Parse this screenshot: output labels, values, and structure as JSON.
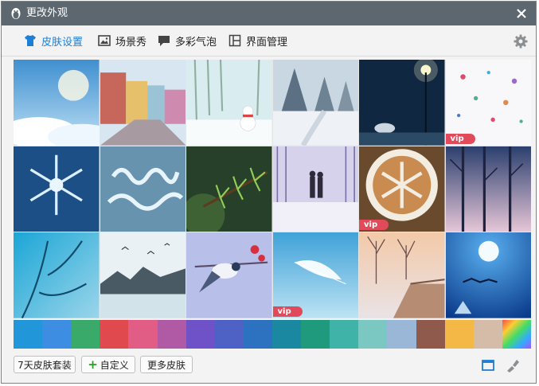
{
  "window": {
    "title": "更改外观"
  },
  "tabs": [
    {
      "label": "皮肤设置",
      "active": true
    },
    {
      "label": "场景秀",
      "active": false
    },
    {
      "label": "多彩气泡",
      "active": false
    },
    {
      "label": "界面管理",
      "active": false
    }
  ],
  "skins": [
    {
      "subject": "sky and clouds",
      "vip": false
    },
    {
      "subject": "colorful street",
      "vip": false
    },
    {
      "subject": "snowman forest",
      "vip": false
    },
    {
      "subject": "snowy pine trees",
      "vip": false
    },
    {
      "subject": "night lamp with umbrella",
      "vip": false
    },
    {
      "subject": "snowflake pattern",
      "vip": true,
      "badge": "vip"
    },
    {
      "subject": "ice snowflake",
      "vip": false
    },
    {
      "subject": "Merry Christmas frost",
      "vip": false
    },
    {
      "subject": "pine branch",
      "vip": false
    },
    {
      "subject": "couple in snow",
      "vip": false
    },
    {
      "subject": "latte art snowflake",
      "vip": true,
      "badge": "vip"
    },
    {
      "subject": "purple winter forest",
      "vip": false
    },
    {
      "subject": "icy branches",
      "vip": false
    },
    {
      "subject": "frozen lake with birds",
      "vip": false
    },
    {
      "subject": "bird on branch",
      "vip": false
    },
    {
      "subject": "white feather",
      "vip": true,
      "badge": "vip"
    },
    {
      "subject": "sunset walkway",
      "vip": false
    },
    {
      "subject": "moon and reindeer",
      "vip": false
    }
  ],
  "swatches": [
    "#2196d8",
    "#3d8de3",
    "#3aaa6b",
    "#e04a4f",
    "#e25d85",
    "#b05aa6",
    "#6f52c7",
    "#4e62c5",
    "#2d72c1",
    "#1b88a2",
    "#1f9a7c",
    "#3fb3a8",
    "#7bc8c2",
    "#9ab7d8",
    "#8f5a4c",
    "#f3b846",
    "#d4bca8",
    "rainbow"
  ],
  "bottom": {
    "btn_7days": "7天皮肤套装",
    "btn_custom": "自定义",
    "btn_more": "更多皮肤"
  },
  "colors": {
    "titlebar": "#5d676f",
    "accent": "#1e7fd6",
    "vip": "#e04a5a"
  },
  "icons": [
    "penguin-icon",
    "close-icon",
    "shirt-icon",
    "image-icon",
    "chat-bubble-icon",
    "layout-icon",
    "gear-icon",
    "window-icon",
    "brush-icon"
  ]
}
